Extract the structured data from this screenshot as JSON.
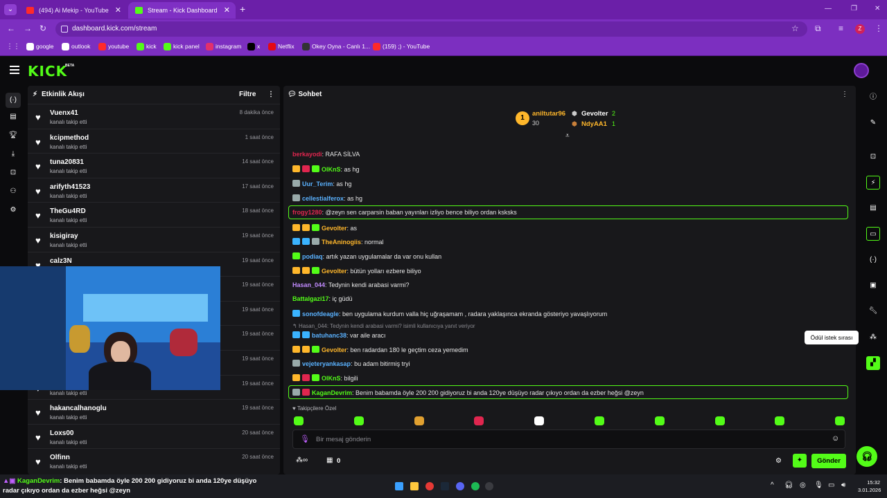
{
  "browser": {
    "tabs": [
      {
        "title": "(494) Ai Mekip - YouTube",
        "color": "#ff2a2a"
      },
      {
        "title": "Stream - Kick Dashboard",
        "color": "#53fc18"
      }
    ],
    "new_tab": "+",
    "url": "dashboard.kick.com/stream",
    "profile_initial": "Z",
    "bookmarks": [
      {
        "label": "google",
        "color": "#ffffff"
      },
      {
        "label": "outlook",
        "color": "#ffffff"
      },
      {
        "label": "youtube",
        "color": "#ff2a2a"
      },
      {
        "label": "kick",
        "color": "#53fc18"
      },
      {
        "label": "kick panel",
        "color": "#53fc18"
      },
      {
        "label": "instagram",
        "color": "#e1306c"
      },
      {
        "label": "x",
        "color": "#000000"
      },
      {
        "label": "Netflix",
        "color": "#e50914"
      },
      {
        "label": "Okey Oyna - Canlı 1...",
        "color": "#333333"
      },
      {
        "label": "(159) ;) - YouTube",
        "color": "#ff2a2a"
      }
    ]
  },
  "kick": {
    "logo": "KICK",
    "beta": "BETA",
    "activity": {
      "title": "Etkinlik Akışı",
      "filter": "Filtre",
      "events": [
        {
          "name": "Vuenx41",
          "action": "kanalı takip etti",
          "time": "8 dakika önce"
        },
        {
          "name": "kcipmethod",
          "action": "kanalı takip etti",
          "time": "1 saat önce"
        },
        {
          "name": "tuna20831",
          "action": "kanalı takip etti",
          "time": "14 saat önce"
        },
        {
          "name": "arifyth41523",
          "action": "kanalı takip etti",
          "time": "17 saat önce"
        },
        {
          "name": "TheGu4RD",
          "action": "kanalı takip etti",
          "time": "18 saat önce"
        },
        {
          "name": "kisigiray",
          "action": "kanalı takip etti",
          "time": "19 saat önce"
        },
        {
          "name": "calz3N",
          "action": "kanalı takip etti",
          "time": "19 saat önce"
        },
        {
          "name": "",
          "action": "",
          "time": "19 saat önce"
        },
        {
          "name": "",
          "action": "",
          "time": "19 saat önce"
        },
        {
          "name": "",
          "action": "",
          "time": "19 saat önce"
        },
        {
          "name": "",
          "action": "",
          "time": "19 saat önce"
        },
        {
          "name": "",
          "action": "kanalı takip etti",
          "time": "19 saat önce"
        },
        {
          "name": "hakancalhanoglu",
          "action": "kanalı takip etti",
          "time": "19 saat önce"
        },
        {
          "name": "Loxs00",
          "action": "kanalı takip etti",
          "time": "20 saat önce"
        },
        {
          "name": "Olfinn",
          "action": "kanalı takip etti",
          "time": "20 saat önce"
        }
      ]
    },
    "chat": {
      "title": "Sohbet",
      "leaderboard": {
        "first": {
          "rank": "1",
          "name": "aniltutar96",
          "count": "30"
        },
        "second": {
          "name": "Gevolter",
          "count": "2"
        },
        "third": {
          "name": "NdyAA1",
          "count": "1"
        }
      },
      "messages": [
        {
          "user": "berkayodi",
          "color": "#e0264f",
          "text": ": RAFA SİLVA"
        },
        {
          "user": "OlKnS",
          "color": "#53fc18",
          "text": ": as hg"
        },
        {
          "user": "Uur_Terim",
          "color": "#5ab2ff",
          "text": ": as hg"
        },
        {
          "user": "cellestialferox",
          "color": "#5ab2ff",
          "text": ": as hg"
        },
        {
          "user": "frogy1280",
          "color": "#e0264f",
          "text": ": @zeyn sen carparsin baban yayınları izliyo bence biliyo ordan ksksks"
        },
        {
          "user": "Gevolter",
          "color": "#ffb72b",
          "text": ": as"
        },
        {
          "user": "TheAninogiis",
          "color": "#ffb72b",
          "text": ": normal"
        },
        {
          "user": "podiaq",
          "color": "#5ab2ff",
          "text": ": artık yazan uygulamalar da var onu kullan"
        },
        {
          "user": "Gevolter",
          "color": "#ffb72b",
          "text": ": bütün yolları ezbere biliyo"
        },
        {
          "user": "Hasan_044",
          "color": "#c18bff",
          "text": ": Tedynin kendi arabasi varmi?"
        },
        {
          "user": "Battalgazi17",
          "color": "#53fc18",
          "text": ": iç güdü"
        },
        {
          "user": "sonofdeagle",
          "color": "#5ab2ff",
          "text": ": ben uygulama kurdum valla hiç uğraşamam , radara yaklaşınca ekranda gösteriyo yavaşlıyorum"
        },
        {
          "user": "batuhanc38",
          "color": "#5ab2ff",
          "text": ": var aile aracı"
        },
        {
          "user": "Gevolter",
          "color": "#ffb72b",
          "text": ": ben radardan 180 le geçtim ceza yemedim"
        },
        {
          "user": "vejeteryankasap",
          "color": "#5ab2ff",
          "text": ": bu adam bitirmiş tryi"
        },
        {
          "user": "OlKnS",
          "color": "#53fc18",
          "text": ": bilgili"
        },
        {
          "user": "KaganDevrim",
          "color": "#53fc18",
          "text": ": Benim babamda öyle 200 200 gidiyoruz bi anda 120ye düşüyo radar çıkıyo ordan da ezber heğsi @zeyn"
        }
      ],
      "reply_context": "Hasan_044: Tedynin kendi arabasi varmi? isimli kullanıcıya yanıt veriyor",
      "followers_only": "Takipçilere Özel",
      "input_placeholder": "Bir mesaj gönderin",
      "points": "0",
      "send": "Gönder"
    },
    "tooltip": "Ödül istek sırası"
  },
  "taskbar": {
    "ticker_user": "KaganDevrim",
    "ticker_text": ": Benim babamda öyle 200 200 gidiyoruz bi anda 120ye düşüyo",
    "ticker_text2": "radar çıkıyo ordan da ezber heğsi @zeyn",
    "time": "15:32",
    "date": "3.01.2026"
  }
}
